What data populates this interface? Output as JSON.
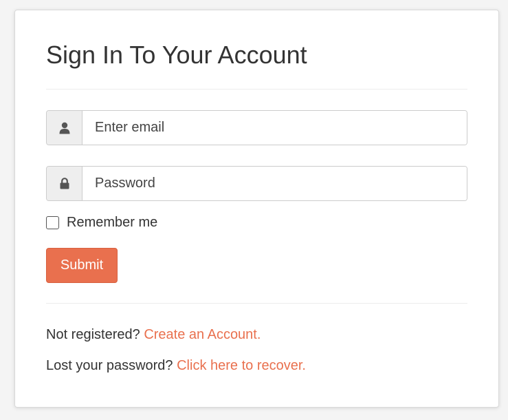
{
  "title": "Sign In To Your Account",
  "email": {
    "placeholder": "Enter email",
    "value": "",
    "icon": "user-icon"
  },
  "password": {
    "placeholder": "Password",
    "value": "",
    "icon": "lock-icon"
  },
  "remember": {
    "label": "Remember me",
    "checked": false
  },
  "submit_label": "Submit",
  "register": {
    "prompt": "Not registered?",
    "link": "Create an Account."
  },
  "recover": {
    "prompt": "Lost your password?",
    "link": "Click here to recover."
  },
  "colors": {
    "accent": "#e9704e",
    "text": "#333333",
    "addon_bg": "#eeeeee",
    "border": "#cccccc"
  }
}
